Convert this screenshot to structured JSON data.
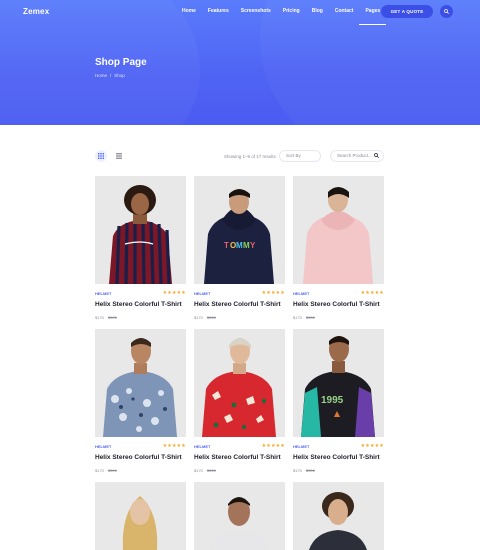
{
  "header": {
    "logo": "Zemex",
    "nav": [
      "Home",
      "Features",
      "Screenshots",
      "Pricing",
      "Blog",
      "Contact",
      "Pages"
    ],
    "active_nav_index": 6,
    "cta_label": "GET A QUOTE",
    "search_icon": "search-icon"
  },
  "hero": {
    "title": "Shop Page",
    "breadcrumb": {
      "home": "Home",
      "separator": "/",
      "current": "Shop"
    }
  },
  "toolbar": {
    "results_text": "Showing 1–9 of 17 results",
    "sort_label": "Sort By",
    "search_placeholder": "Search Product..."
  },
  "colors": {
    "accent": "#4f63f4",
    "stars": "#f5a623"
  },
  "products": [
    {
      "category": "HELMET",
      "rating": "★★★★★",
      "title": "Helix Stereo Colorful T-Shirt",
      "price": "$170",
      "old_price": "$300"
    },
    {
      "category": "HELMET",
      "rating": "★★★★★",
      "title": "Helix Stereo Colorful T-Shirt",
      "price": "$170",
      "old_price": "$300"
    },
    {
      "category": "HELMET",
      "rating": "★★★★★",
      "title": "Helix Stereo Colorful T-Shirt",
      "price": "$170",
      "old_price": "$300"
    },
    {
      "category": "HELMET",
      "rating": "★★★★★",
      "title": "Helix Stereo Colorful T-Shirt",
      "price": "$170",
      "old_price": "$300"
    },
    {
      "category": "HELMET",
      "rating": "★★★★★",
      "title": "Helix Stereo Colorful T-Shirt",
      "price": "$170",
      "old_price": "$300"
    },
    {
      "category": "HELMET",
      "rating": "★★★★★",
      "title": "Helix Stereo Colorful T-Shirt",
      "price": "$170",
      "old_price": "$300"
    }
  ]
}
